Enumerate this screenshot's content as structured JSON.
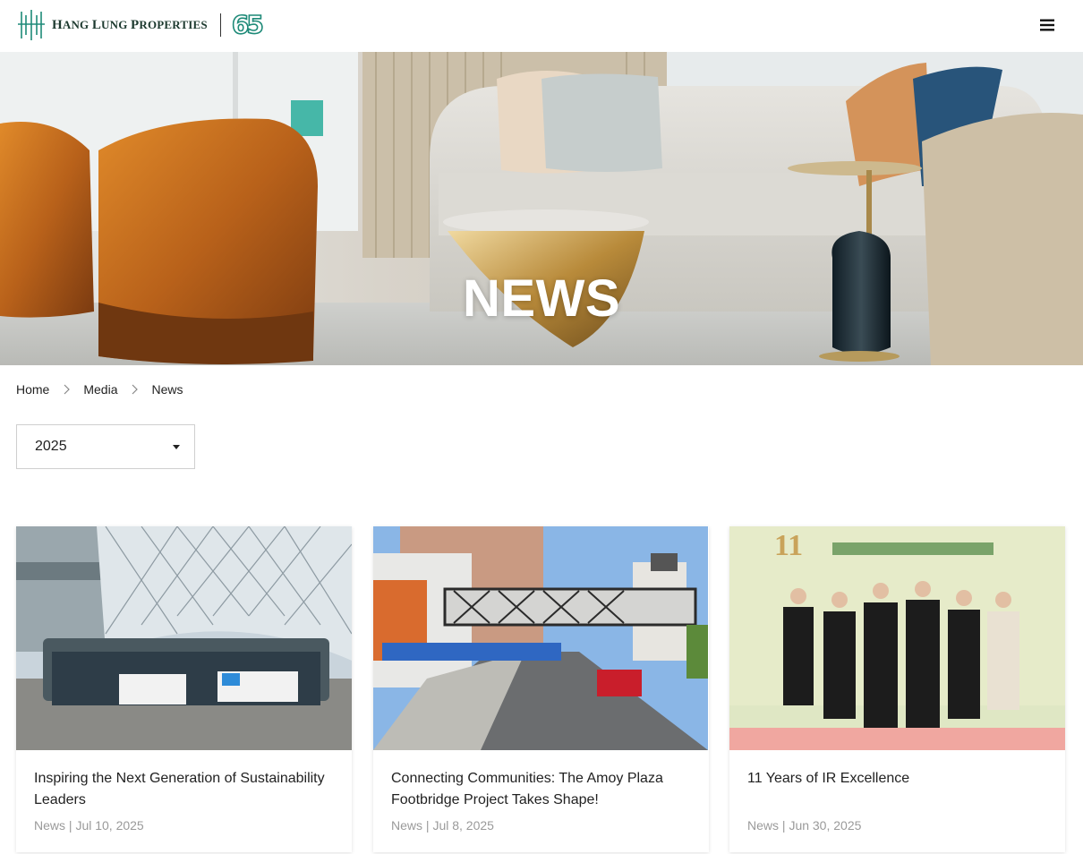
{
  "header": {
    "brand_name": "Hang Lung Properties",
    "brand_name_display_1": "H",
    "brand_name_display_2": "ANG ",
    "brand_name_display_3": "L",
    "brand_name_display_4": "UNG ",
    "brand_name_display_5": "P",
    "brand_name_display_6": "ROPERTIES",
    "anniversary": "65",
    "menu_icon": "hamburger-menu-icon"
  },
  "hero": {
    "title": "NEWS"
  },
  "breadcrumb": {
    "items": [
      "Home",
      "Media",
      "News"
    ]
  },
  "filter": {
    "year": "2025"
  },
  "news": {
    "items": [
      {
        "title": "Inspiring the Next Generation of Sustainability Leaders",
        "category": "News",
        "date": "Jul 10, 2025"
      },
      {
        "title": "Connecting Communities: The Amoy Plaza Footbridge Project Takes Shape!",
        "category": "News",
        "date": "Jul 8, 2025"
      },
      {
        "title": "11 Years of IR Excellence",
        "category": "News",
        "date": "Jun 30, 2025"
      }
    ]
  },
  "colors": {
    "brand_green": "#1d3a2f",
    "anniversary_teal": "#1e8a78",
    "meta_gray": "#9a9a9a"
  }
}
